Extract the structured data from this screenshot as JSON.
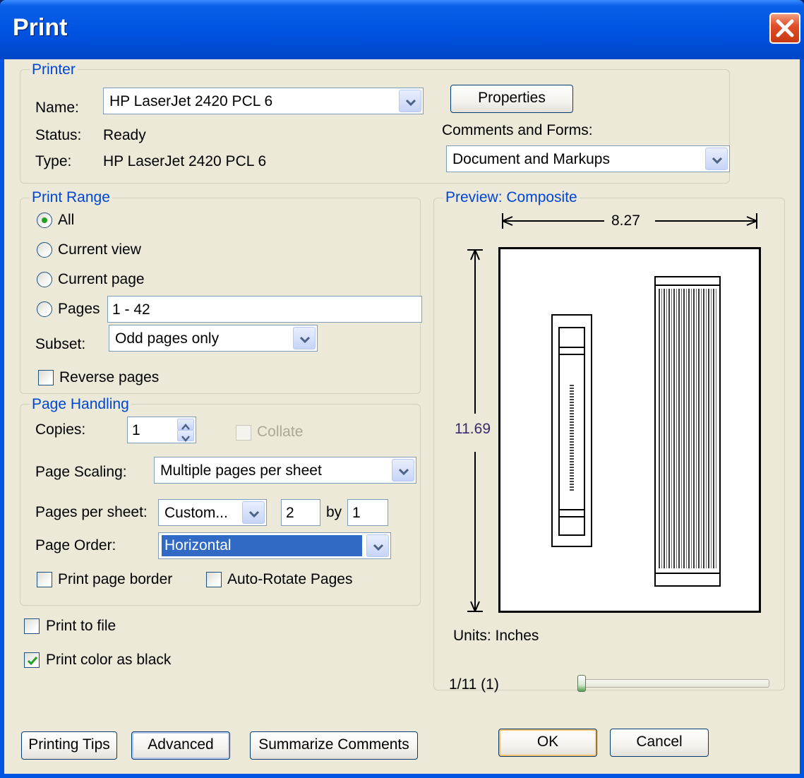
{
  "window": {
    "title": "Print"
  },
  "printer": {
    "legend": "Printer",
    "name_label": "Name:",
    "name_value": "HP LaserJet 2420 PCL 6",
    "status_label": "Status:",
    "status_value": "Ready",
    "type_label": "Type:",
    "type_value": "HP LaserJet 2420 PCL 6",
    "properties_button": "Properties",
    "comments_label": "Comments and Forms:",
    "comments_value": "Document and Markups"
  },
  "print_range": {
    "legend": "Print Range",
    "all": "All",
    "current_view": "Current view",
    "current_page": "Current page",
    "pages": "Pages",
    "pages_value": "1 - 42",
    "subset_label": "Subset:",
    "subset_value": "Odd pages only",
    "reverse_pages": "Reverse pages",
    "selected": "all"
  },
  "page_handling": {
    "legend": "Page Handling",
    "copies_label": "Copies:",
    "copies_value": "1",
    "collate": "Collate",
    "page_scaling_label": "Page Scaling:",
    "page_scaling_value": "Multiple pages per sheet",
    "pages_per_sheet_label": "Pages per sheet:",
    "pages_per_sheet_value": "Custom...",
    "pps_x": "2",
    "by_label": "by",
    "pps_y": "1",
    "page_order_label": "Page Order:",
    "page_order_value": "Horizontal",
    "print_page_border": "Print page border",
    "auto_rotate": "Auto-Rotate Pages"
  },
  "options": {
    "print_to_file": "Print to file",
    "print_to_file_checked": false,
    "print_color_as_black": "Print color as black",
    "print_color_as_black_checked": true
  },
  "preview": {
    "legend": "Preview: Composite",
    "width_label": "8.27",
    "height_label": "11.69",
    "units": "Units: Inches",
    "page_indicator": "1/11 (1)",
    "slider_position": 0
  },
  "buttons": {
    "printing_tips": "Printing Tips",
    "advanced": "Advanced",
    "summarize": "Summarize Comments",
    "ok": "OK",
    "cancel": "Cancel"
  },
  "colors": {
    "accent": "#0046d5",
    "title_bar": "#0053e1",
    "dialog_bg": "#ece9d8",
    "selection": "#316ac5",
    "close": "#e0502a"
  },
  "icons": {
    "close": "close-icon",
    "dropdown": "chevron-down-icon",
    "check": "checkmark-icon"
  }
}
